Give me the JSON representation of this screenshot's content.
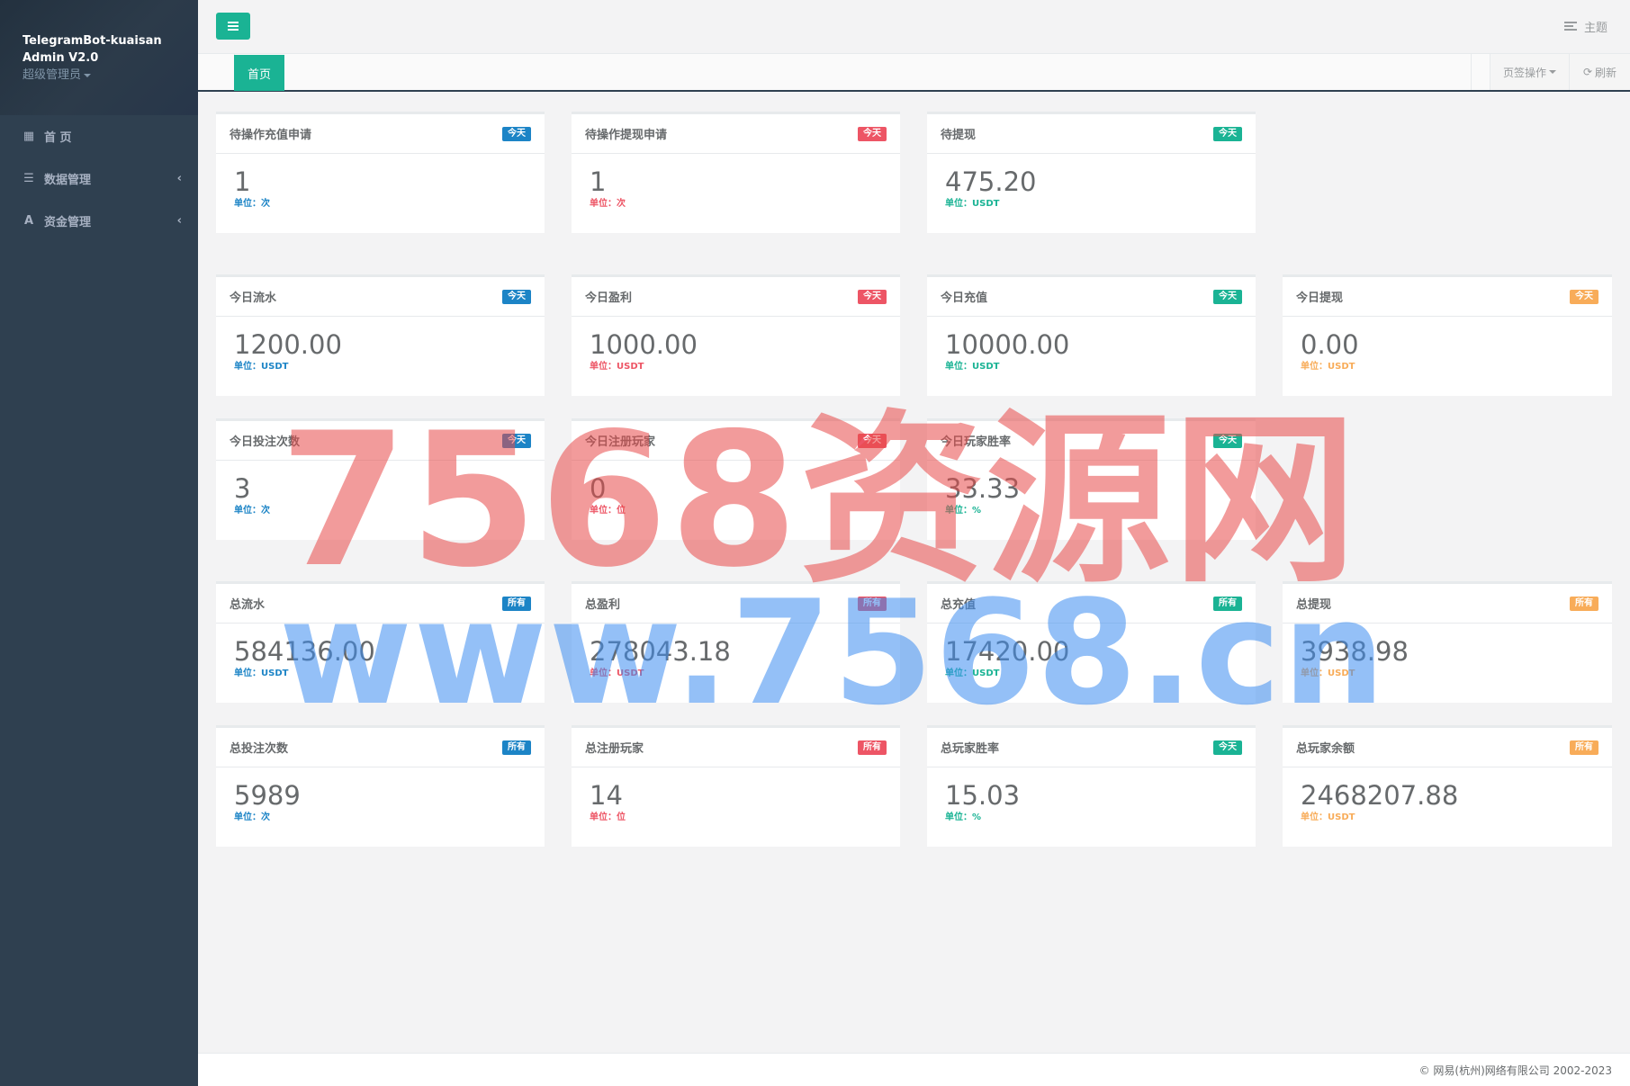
{
  "sidebar": {
    "app_title_line1": "TelegramBot-kuaisan",
    "app_title_line2": "Admin V2.0",
    "role": "超级管理员",
    "items": [
      {
        "label": "首 页",
        "icon": "dashboard-grid-icon",
        "glyph": "▦",
        "chevron": ""
      },
      {
        "label": "数据管理",
        "icon": "list-icon",
        "glyph": "☰",
        "chevron": "‹"
      },
      {
        "label": "资金管理",
        "icon": "font-a-icon",
        "glyph": "A",
        "chevron": "‹"
      }
    ]
  },
  "topbar": {
    "theme_label": "主题"
  },
  "tabs": {
    "active_tab": "首页",
    "ops_label": "页签操作",
    "refresh_label": "刷新"
  },
  "cards": {
    "pending_recharge": {
      "title": "待操作充值申请",
      "badge": "今天",
      "value": "1",
      "unit": "单位：次"
    },
    "pending_withdraw_req": {
      "title": "待操作提现申请",
      "badge": "今天",
      "value": "1",
      "unit": "单位：次"
    },
    "pending_withdraw": {
      "title": "待提现",
      "badge": "今天",
      "value": "475.20",
      "unit": "单位：USDT"
    },
    "today_flow": {
      "title": "今日流水",
      "badge": "今天",
      "value": "1200.00",
      "unit": "单位：USDT"
    },
    "today_profit": {
      "title": "今日盈利",
      "badge": "今天",
      "value": "1000.00",
      "unit": "单位：USDT"
    },
    "today_recharge": {
      "title": "今日充值",
      "badge": "今天",
      "value": "10000.00",
      "unit": "单位：USDT"
    },
    "today_withdraw": {
      "title": "今日提现",
      "badge": "今天",
      "value": "0.00",
      "unit": "单位：USDT"
    },
    "today_bets": {
      "title": "今日投注次数",
      "badge": "今天",
      "value": "3",
      "unit": "单位：次"
    },
    "today_registered": {
      "title": "今日注册玩家",
      "badge": "今天",
      "value": "0",
      "unit": "单位：位"
    },
    "today_winrate": {
      "title": "今日玩家胜率",
      "badge": "今天",
      "value": "33.33",
      "unit": "单位：%"
    },
    "total_flow": {
      "title": "总流水",
      "badge": "所有",
      "value": "584136.00",
      "unit": "单位：USDT"
    },
    "total_profit": {
      "title": "总盈利",
      "badge": "所有",
      "value": "278043.18",
      "unit": "单位：USDT"
    },
    "total_recharge": {
      "title": "总充值",
      "badge": "所有",
      "value": "17420.00",
      "unit": "单位：USDT"
    },
    "total_withdraw": {
      "title": "总提现",
      "badge": "所有",
      "value": "3938.98",
      "unit": "单位：USDT"
    },
    "total_bets": {
      "title": "总投注次数",
      "badge": "所有",
      "value": "5989",
      "unit": "单位：次"
    },
    "total_registered": {
      "title": "总注册玩家",
      "badge": "所有",
      "value": "14",
      "unit": "单位：位"
    },
    "total_winrate": {
      "title": "总玩家胜率",
      "badge": "今天",
      "value": "15.03",
      "unit": "单位：%"
    },
    "total_balance": {
      "title": "总玩家余额",
      "badge": "所有",
      "value": "2468207.88",
      "unit": "单位：USDT"
    }
  },
  "footer": {
    "copyright": "© 网易(杭州)网络有限公司 2002-2023"
  },
  "watermark": {
    "line1": "7568资源网",
    "line2": "www.7568.cn"
  },
  "colors": {
    "sidebar": "#2f4050",
    "accent_green": "#1ab394",
    "badge_blue": "#1c84c6",
    "badge_red": "#ed5565",
    "badge_orange": "#f8ac59"
  }
}
